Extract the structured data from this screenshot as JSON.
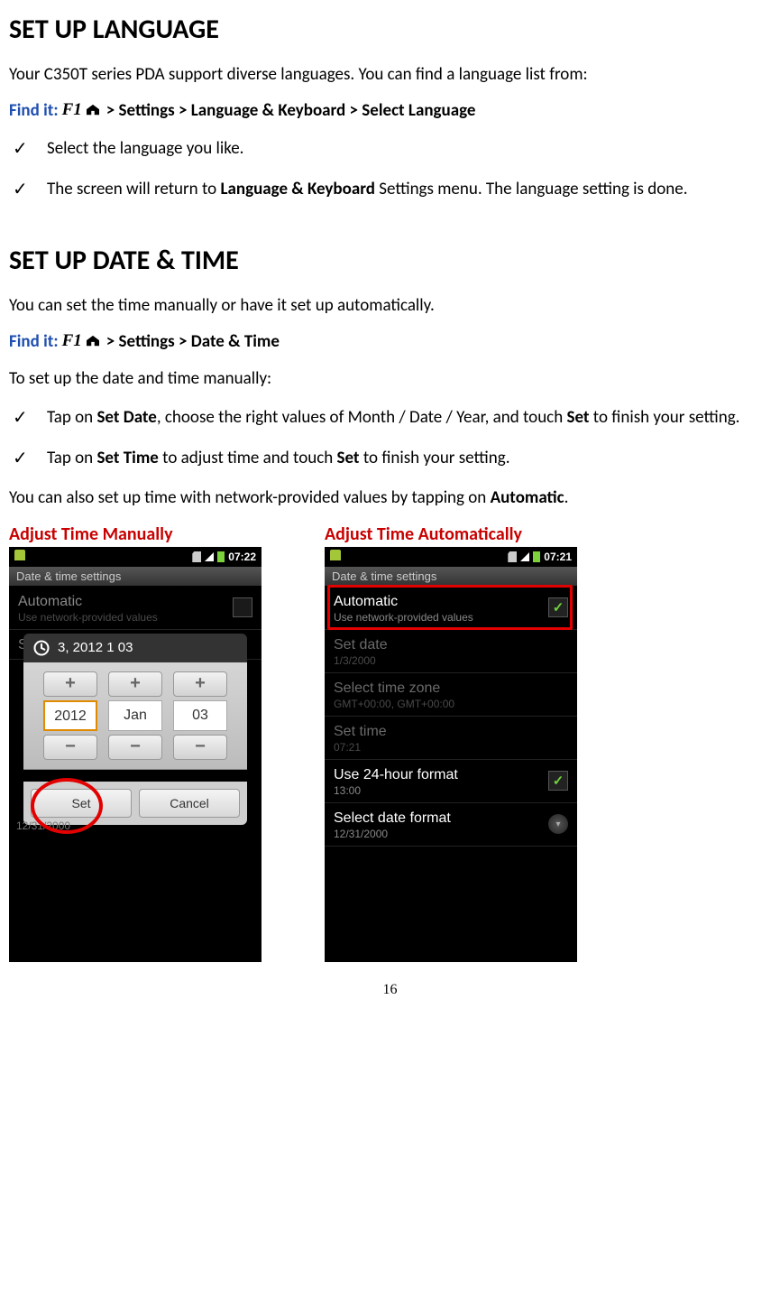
{
  "section1": {
    "heading": "SET UP LANGUAGE",
    "intro": "Your C350T series PDA support diverse languages. You can find a language list from:",
    "findit_label": "Find it:",
    "findit_path": "  > Settings > Language & Keyboard > Select Language",
    "check1": "Select the language you like.",
    "check2_pre": "The screen will return to ",
    "check2_bold": "Language & Keyboard",
    "check2_post": " Settings menu. The language setting is done."
  },
  "section2": {
    "heading": "SET UP DATE & TIME",
    "intro": "You can set the time manually or have it set up automatically.",
    "findit_label": "Find it:",
    "findit_path": "  > Settings > Date & Time",
    "manual_intro": "To set up the date and time manually:",
    "check1_pre": "Tap on ",
    "check1_b1": "Set Date",
    "check1_mid": ", choose the right values of Month / Date / Year, and touch ",
    "check1_b2": "Set",
    "check1_post": " to finish your setting.",
    "check2_pre": "Tap on ",
    "check2_b1": "Set Time",
    "check2_mid": " to adjust time and touch ",
    "check2_b2": "Set",
    "check2_post": " to finish your setting.",
    "auto_line_pre": "You can also set up time with network-provided values by tapping on ",
    "auto_line_bold": "Automatic",
    "auto_line_post": ".",
    "caption_manual": "Adjust Time Manually",
    "caption_auto": "Adjust Time Automatically"
  },
  "phone_manual": {
    "clock": "07:22",
    "title": "Date & time settings",
    "automatic": "Automatic",
    "automatic_sub": "Use network-provided values",
    "set_date": "Set date",
    "picker_title": "3, 2012 1 03",
    "year": "2012",
    "month": "Jan",
    "day": "03",
    "plus": "+",
    "minus": "−",
    "set": "Set",
    "cancel": "Cancel",
    "below_date": "12/31/2000"
  },
  "phone_auto": {
    "clock": "07:21",
    "title": "Date & time settings",
    "automatic": "Automatic",
    "automatic_sub": "Use network-provided values",
    "set_date": "Set date",
    "set_date_sub": "1/3/2000",
    "tz": "Select time zone",
    "tz_sub": "GMT+00:00, GMT+00:00",
    "set_time": "Set time",
    "set_time_sub": "07:21",
    "h24": "Use 24-hour format",
    "h24_sub": "13:00",
    "fmt": "Select date format",
    "fmt_sub": "12/31/2000"
  },
  "page_number": "16"
}
